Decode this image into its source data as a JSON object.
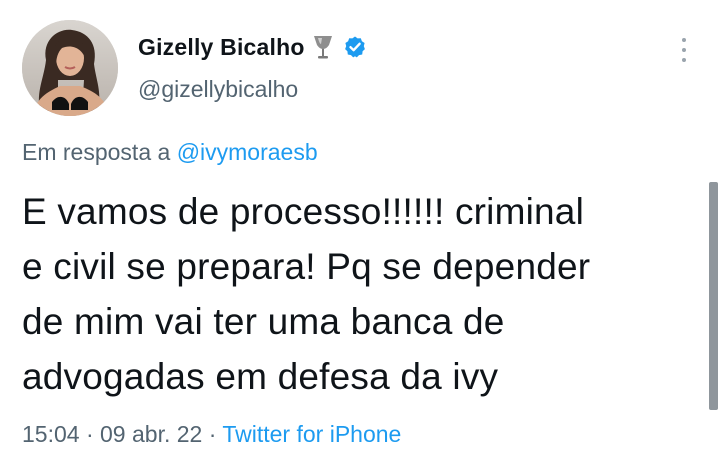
{
  "author": {
    "display_name": "Gizelly Bicalho",
    "handle": "@gizellybicalho",
    "name_emoji": "trophy-icon",
    "verified": true
  },
  "reply": {
    "prefix": "Em resposta a ",
    "mention": "@ivymoraesb"
  },
  "tweet": {
    "lines": [
      "E vamos de processo!!!!!! criminal",
      "e civil se prepara! Pq se depender",
      "de mim vai ter uma banca de",
      "advogadas em defesa da ivy"
    ]
  },
  "meta": {
    "time": "15:04",
    "separator": " · ",
    "date": "09 abr. 22",
    "source": "Twitter for iPhone"
  },
  "colors": {
    "accent": "#1d9bf0",
    "secondary_text": "#536471",
    "primary_text": "#0f1419"
  },
  "icons": {
    "menu": "more-vertical-icon",
    "verified": "verified-badge-icon"
  }
}
